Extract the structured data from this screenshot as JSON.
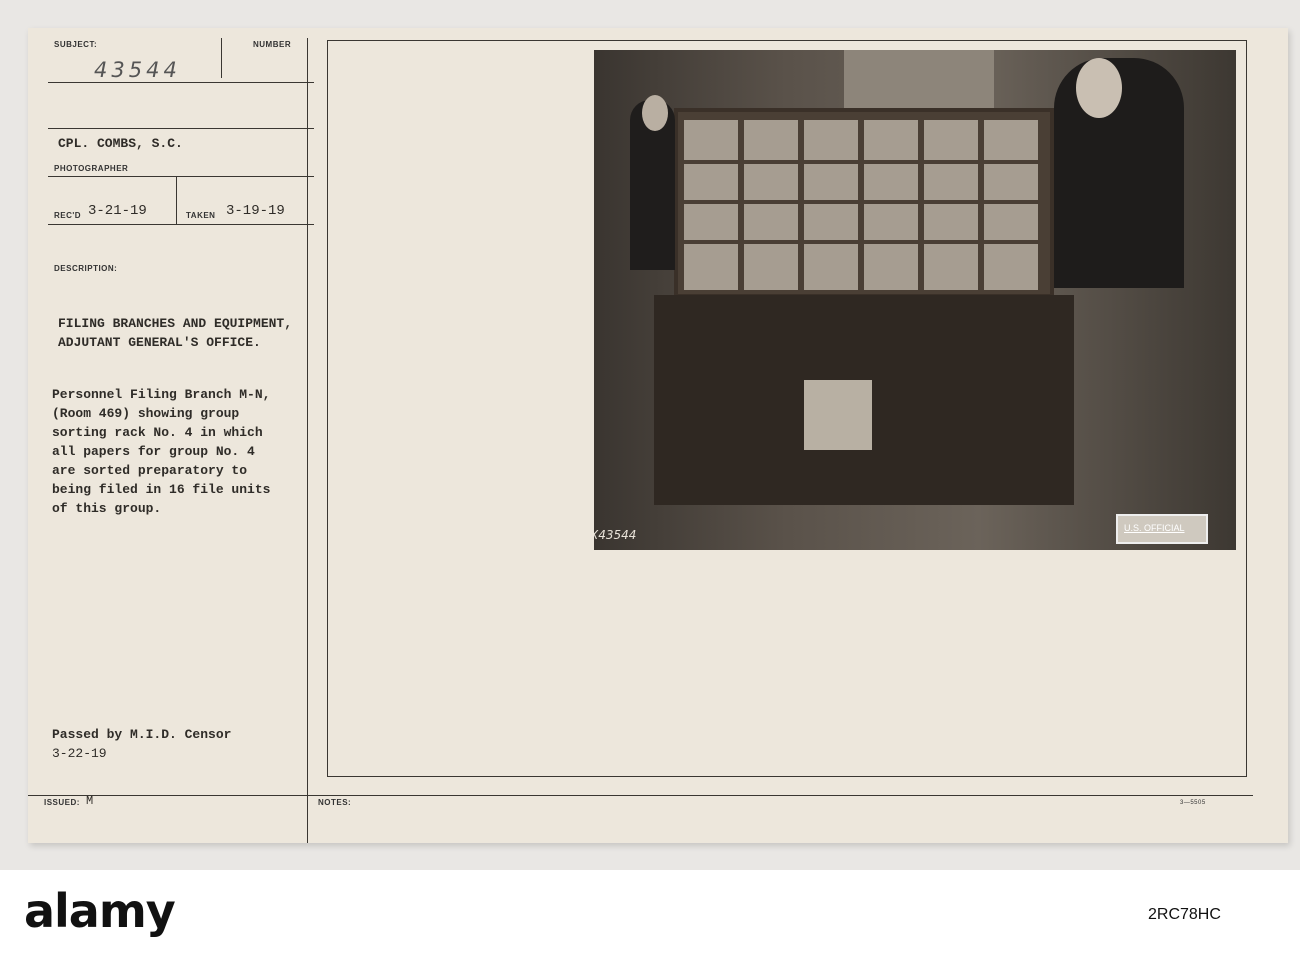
{
  "card": {
    "subject_label": "SUBJECT:",
    "number_label": "NUMBER",
    "subject_number": "43544",
    "photographer": "CPL. COMBS, S.C.",
    "photographer_label": "PHOTOGRAPHER",
    "recd_label": "REC'D",
    "recd_date": "3-21-19",
    "taken_label": "TAKEN",
    "taken_date": "3-19-19",
    "description_label": "DESCRIPTION:",
    "description_title": "FILING BRANCHES AND EQUIPMENT,\nADJUTANT GENERAL'S OFFICE.",
    "description_body": "Personnel Filing Branch M-N,\n(Room 469) showing group\nsorting rack No. 4 in which\nall papers for group No. 4\nare sorted preparatory to\nbeing filed in 16 file units\nof this group.",
    "censor": "Passed by M.I.D. Censor",
    "censor_date": "3-22-19",
    "issued_label": "ISSUED:",
    "issued_value": "M",
    "notes_label": "NOTES:",
    "form_number": "3—5505"
  },
  "photo": {
    "negative_number": "X43544",
    "stamp": "U.S. OFFICIAL"
  },
  "footer": {
    "logo": "alamy",
    "image_id": "2RC78HC"
  },
  "watermark": "alamy"
}
